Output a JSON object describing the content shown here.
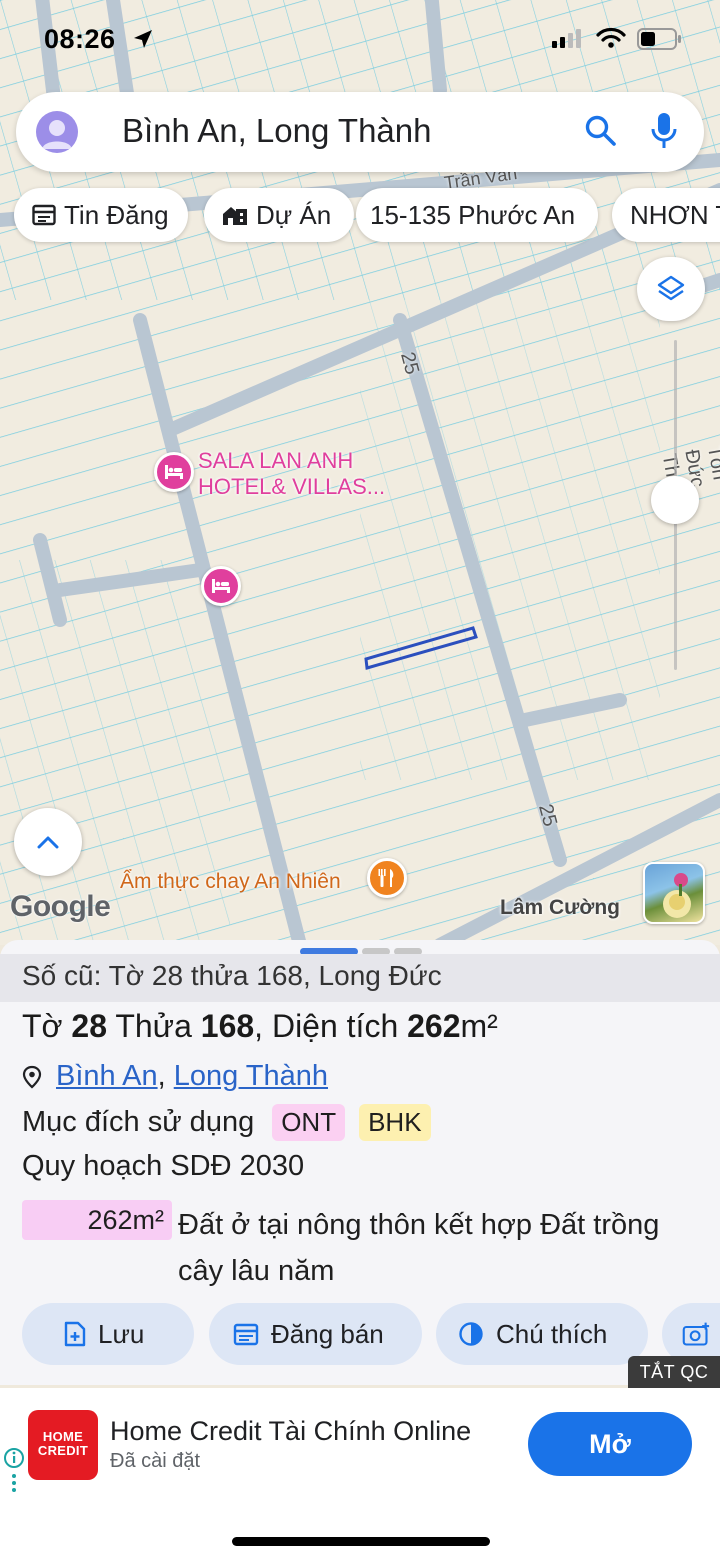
{
  "status_bar": {
    "time": "08:26"
  },
  "search": {
    "query": "Bình An, Long Thành"
  },
  "chips": [
    {
      "label": "Tin Đăng",
      "icon": "listing-icon"
    },
    {
      "label": "Dự Án",
      "icon": "building-icon"
    },
    {
      "label": "15-135 Phước An",
      "icon": ""
    },
    {
      "label": "NHƠN T",
      "icon": ""
    }
  ],
  "map": {
    "pois": [
      {
        "label_line1": "SALA LAN ANH",
        "label_line2": "HOTEL& VILLAS...",
        "icon": "hotel-icon"
      },
      {
        "label_line1": "",
        "label_line2": "",
        "icon": "hotel-icon"
      }
    ],
    "food_label": "Ẩm thực chay An Nhiên",
    "road_labels": {
      "road_25_top": "25",
      "road_25_bottom": "25",
      "ton_duc": "Tôn Đức Th",
      "tran_van": "Trần Văn"
    },
    "google_label": "Google",
    "place_label": "Lâm Cường",
    "colors": {
      "parcel_line": "#79cde0",
      "road": "#b9c6d2",
      "selected_parcel": "#2b4fbe"
    }
  },
  "sheet": {
    "old_info": "Số cũ: Tờ 28 thửa 168, Long Đức",
    "title_pre": "Tờ ",
    "to_num": "28",
    "title_mid": " Thửa ",
    "thua_num": "168",
    "title_mid2": ", Diện tích ",
    "area": "262",
    "area_unit": "m²",
    "location_1": "Bình An",
    "location_sep": ",",
    "location_2": "Long Thành",
    "purpose_label": "Mục đích sử dụng",
    "tag_ont": "ONT",
    "tag_bhk": "BHK",
    "plan_label": "Quy hoạch SDĐ 2030",
    "plan_area": "262m²",
    "plan_desc": "Đất ở tại nông thôn kết hợp Đất trồng cây lâu năm",
    "actions": [
      {
        "label": "Lưu",
        "icon": "save-icon"
      },
      {
        "label": "Đăng bán",
        "icon": "post-icon"
      },
      {
        "label": "Chú thích",
        "icon": "contrast-icon"
      }
    ]
  },
  "ad": {
    "close_label": "TẮT QC",
    "logo_line1": "HOME",
    "logo_line2": "CREDIT",
    "title": "Home Credit Tài Chính Online",
    "subtitle": "Đã cài đặt",
    "button": "Mở"
  }
}
